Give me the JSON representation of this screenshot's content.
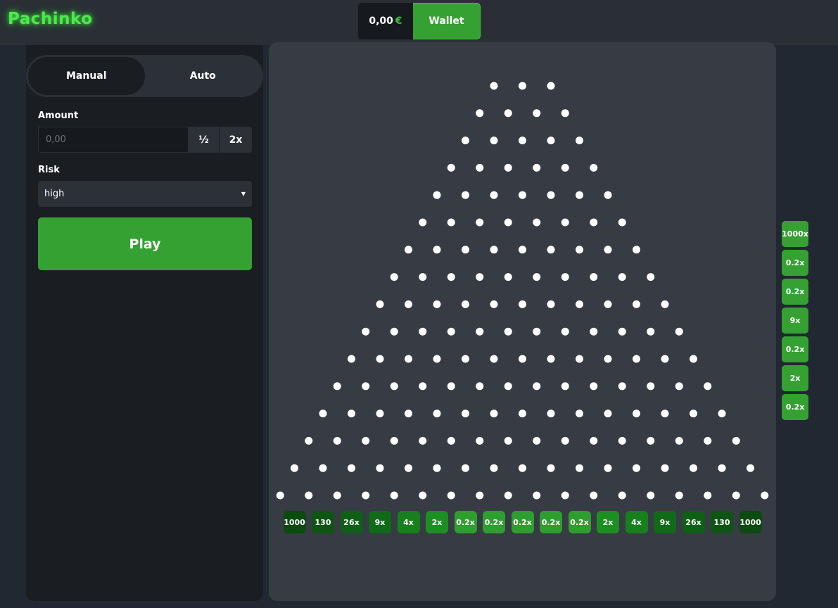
{
  "header": {
    "logo": "Pachinko",
    "balance": "0,00",
    "currency": "€",
    "wallet_label": "Wallet"
  },
  "sidebar": {
    "tabs": [
      {
        "label": "Manual",
        "active": true
      },
      {
        "label": "Auto",
        "active": false
      }
    ],
    "amount_label": "Amount",
    "amount_placeholder": "0,00",
    "amount_value": "",
    "half_label": "½",
    "double_label": "2x",
    "risk_label": "Risk",
    "risk_value": "high",
    "play_label": "Play"
  },
  "board": {
    "peg_rows": 16,
    "first_row_pegs": 3,
    "multipliers": [
      "1000",
      "130",
      "26x",
      "9x",
      "4x",
      "2x",
      "0.2x",
      "0.2x",
      "0.2x",
      "0.2x",
      "0.2x",
      "2x",
      "4x",
      "9x",
      "26x",
      "130",
      "1000"
    ],
    "multiplier_colors": [
      "#0b4a10",
      "#0e5514",
      "#0f5f16",
      "#116a18",
      "#17801d",
      "#1c8f22",
      "#2e9e2e",
      "#2e9e2e",
      "#2e9e2e",
      "#2e9e2e",
      "#2e9e2e",
      "#1c8f22",
      "#17801d",
      "#116a18",
      "#0f5f16",
      "#0e5514",
      "#0b4a10"
    ]
  },
  "history": [
    "1000x",
    "0.2x",
    "0.2x",
    "9x",
    "0.2x",
    "2x",
    "0.2x"
  ],
  "colors": {
    "accent": "#35a132",
    "logo": "#4ee84e",
    "board": "#373b43",
    "sidebar": "#1a1d21"
  }
}
